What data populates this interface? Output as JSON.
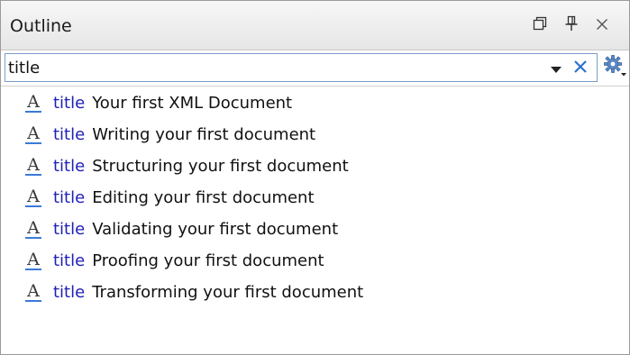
{
  "panel": {
    "title": "Outline",
    "buttons": {
      "restore_icon": "restore-window-icon",
      "pin_icon": "pin-icon",
      "close_icon": "close-icon"
    }
  },
  "filter": {
    "value": "title",
    "dropdown_icon": "dropdown-arrow-icon",
    "clear_icon": "clear-x-icon",
    "settings_icon": "gear-icon"
  },
  "tree": {
    "items": [
      {
        "icon": "text-attribute-icon",
        "icon_glyph": "A",
        "name": "title",
        "text": "Your first XML Document"
      },
      {
        "icon": "text-attribute-icon",
        "icon_glyph": "A",
        "name": "title",
        "text": "Writing your first document"
      },
      {
        "icon": "text-attribute-icon",
        "icon_glyph": "A",
        "name": "title",
        "text": "Structuring your first document"
      },
      {
        "icon": "text-attribute-icon",
        "icon_glyph": "A",
        "name": "title",
        "text": "Editing your first document"
      },
      {
        "icon": "text-attribute-icon",
        "icon_glyph": "A",
        "name": "title",
        "text": "Validating your first document"
      },
      {
        "icon": "text-attribute-icon",
        "icon_glyph": "A",
        "name": "title",
        "text": "Proofing your first document"
      },
      {
        "icon": "text-attribute-icon",
        "icon_glyph": "A",
        "name": "title",
        "text": "Transforming your first document"
      }
    ]
  },
  "colors": {
    "element_name": "#1f1fb8",
    "icon_underline": "#3c7ad6",
    "filter_border": "#7a9cc9"
  }
}
